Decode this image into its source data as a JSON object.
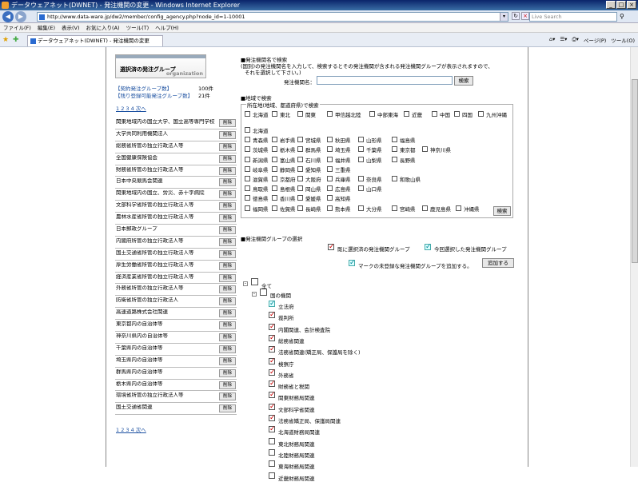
{
  "window": {
    "title": "データウェアネット(DWNET) - 発注機関の変更 - Windows Internet Explorer"
  },
  "address": {
    "url": "http://www.data-ware.jp/dw2/member/config_agency.php?node_id=1-10001",
    "search_placeholder": "Live Search"
  },
  "menu": [
    "ファイル(F)",
    "編集(E)",
    "表示(V)",
    "お気に入り(A)",
    "ツール(T)",
    "ヘルプ(H)"
  ],
  "tab": {
    "label": "データウェアネット(DWNET) - 発注機関の変更"
  },
  "commands": {
    "page": "ページ(P)",
    "tools": "ツール(O)"
  },
  "left": {
    "header_title": "選択済の発注グループ",
    "header_sub": "organization",
    "stat1_label": "【契約発注グループ数】",
    "stat1_value": "100件",
    "stat2_label": "【残り登録可能発注グループ数】",
    "stat2_value": "21件",
    "pager_top": "1 2 3 4 次へ",
    "pager_bottom": "1 2 3 4 次へ",
    "delete_label": "削除",
    "items": [
      "関東地域内の国立大学、国立高等専門学校",
      "大学共同利用機関法人",
      "総務省所管の独立行政法人等",
      "全国健康保険協会",
      "財務省所管の独立行政法人等",
      "日本中央競馬会関連",
      "関東地域内の国立、労災、赤十字病院",
      "文部科学省所管の独立行政法人等",
      "農林水産省所管の独立行政法人等",
      "日本郵政グループ",
      "内閣府所管の独立行政法人等",
      "国土交通省所管の独立行政法人等",
      "厚生労働省所管の独立行政法人等",
      "経済産業省所管の独立行政法人等",
      "外務省所管の独立行政法人等",
      "防衛省所管の独立行政法人",
      "高速道路株式会社関連",
      "東京都内の自治体等",
      "神奈川県内の自治体等",
      "千葉県内の自治体等",
      "埼玉県内の自治体等",
      "群馬県内の自治体等",
      "栃木県内の自治体等",
      "環境省所管の独立行政法人等",
      "国土交通省関連"
    ]
  },
  "right": {
    "name_search": {
      "heading": "■発注機関名で検索",
      "desc1": "(国別)の発注機関名を入力して、検索するとその発注機関が含まれる発注機関グループが表示されますので、",
      "desc2": "それを選択して下さい。)",
      "label": "発注機関名：",
      "button": "検索"
    },
    "region_search": {
      "heading": "■地域で検索",
      "legend": "所在地(地域、都道府県)で検索",
      "regions": [
        "北海道",
        "東北",
        "関東",
        "甲信越北陸",
        "中部東海",
        "近畿",
        "中国",
        "四国",
        "九州沖縄"
      ],
      "prefectures": [
        [
          "北海道"
        ],
        [
          "青森県",
          "岩手県",
          "宮城県",
          "秋田県",
          "山形県",
          "福島県"
        ],
        [
          "茨城県",
          "栃木県",
          "群馬県",
          "埼玉県",
          "千葉県",
          "東京都",
          "神奈川県"
        ],
        [
          "新潟県",
          "富山県",
          "石川県",
          "福井県",
          "山梨県",
          "長野県"
        ],
        [
          "岐阜県",
          "静岡県",
          "愛知県",
          "三重県"
        ],
        [
          "滋賀県",
          "京都府",
          "大阪府",
          "兵庫県",
          "奈良県",
          "和歌山県"
        ],
        [
          "鳥取県",
          "島根県",
          "岡山県",
          "広島県",
          "山口県"
        ],
        [
          "徳島県",
          "香川県",
          "愛媛県",
          "高知県"
        ],
        [
          "福岡県",
          "佐賀県",
          "長崎県",
          "熊本県",
          "大分県",
          "宮崎県",
          "鹿児島県",
          "沖縄県"
        ]
      ],
      "button": "検索"
    },
    "group_select": {
      "heading": "■発注機関グループの選択",
      "opt1": "既に選択済の発注機関グループ",
      "opt2": "今回選択した発注機関グループ",
      "opt3": "マークの未登録な発注機関グループを追加する。",
      "add_button": "追加する"
    },
    "tree": {
      "root": "全て",
      "node": "国の機関",
      "items": [
        {
          "label": "立法府",
          "state": "blue"
        },
        {
          "label": "裁判所",
          "state": "red"
        },
        {
          "label": "内閣関連、会計検査院",
          "state": "red"
        },
        {
          "label": "総務省関連",
          "state": "red"
        },
        {
          "label": "法務省関連(矯正局、保護局を除く)",
          "state": "red"
        },
        {
          "label": "検察庁",
          "state": "red"
        },
        {
          "label": "外務省",
          "state": "red"
        },
        {
          "label": "財務省と税関",
          "state": "red"
        },
        {
          "label": "関東財務局関連",
          "state": "red"
        },
        {
          "label": "文部科学省関連",
          "state": "red"
        },
        {
          "label": "法務省矯正局、保護局関連",
          "state": "red"
        },
        {
          "label": "北海道財務局関連",
          "state": "red"
        },
        {
          "label": "東北財務局関連",
          "state": "none"
        },
        {
          "label": "北陸財務局関連",
          "state": "none"
        },
        {
          "label": "東海財務局関連",
          "state": "none"
        },
        {
          "label": "近畿財務局関連",
          "state": "none"
        }
      ]
    }
  }
}
